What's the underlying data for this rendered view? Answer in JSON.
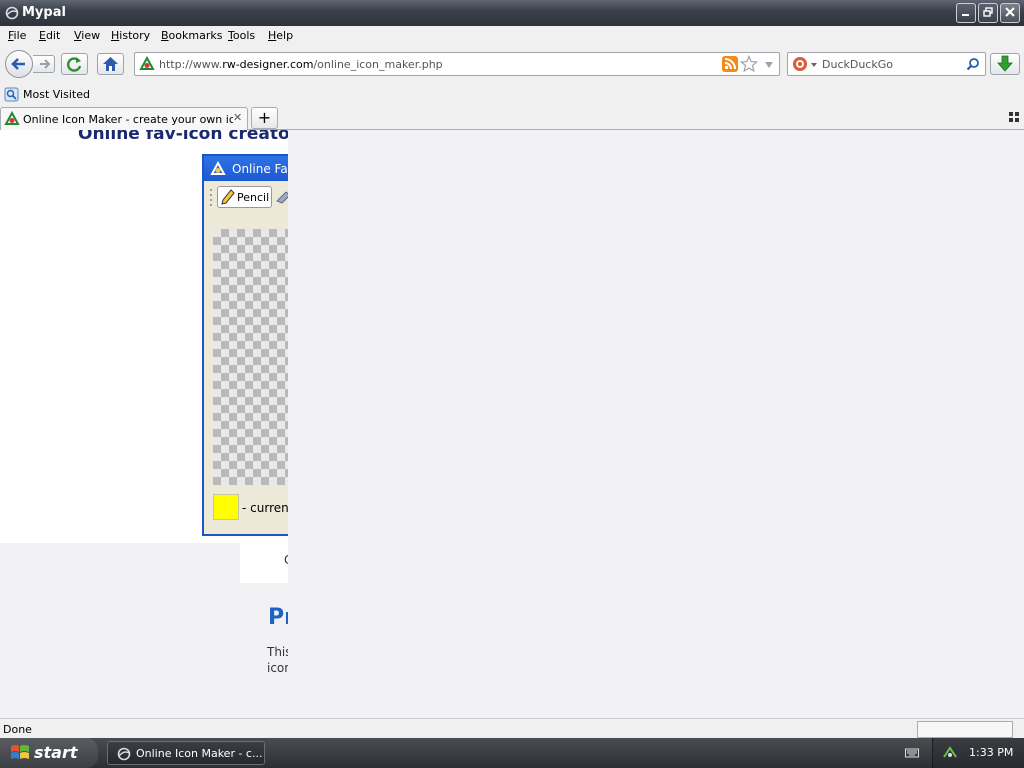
{
  "window": {
    "title": "Mypal"
  },
  "menu": [
    {
      "label": "File",
      "key": "F",
      "rest": "ile"
    },
    {
      "label": "Edit",
      "key": "E",
      "rest": "dit"
    },
    {
      "label": "View",
      "key": "V",
      "rest": "iew"
    },
    {
      "label": "History",
      "key": "H",
      "rest": "istory"
    },
    {
      "label": "Bookmarks",
      "key": "B",
      "rest": "ookmarks"
    },
    {
      "label": "Tools",
      "key": "T",
      "rest": "ools"
    },
    {
      "label": "Help",
      "key": "H",
      "rest": "elp"
    }
  ],
  "nav": {
    "url_prefix": "http://www.",
    "url_domain": "rw-designer.com",
    "url_path": "/online_icon_maker.php",
    "search_engine": "DuckDuckGo"
  },
  "bookmarks": {
    "most_visited": "Most Visited"
  },
  "tabs": [
    {
      "label": "Online Icon Maker - create your own icon..."
    }
  ],
  "page": {
    "heading": "Online fav-icon creator",
    "app_title": "Online Fav",
    "pencil_label": "Pencil",
    "current_label": "- current",
    "lower_char": "C",
    "section_title": "Pr",
    "section_line1": "This",
    "section_line2": "icon"
  },
  "status": {
    "text": "Done"
  },
  "taskbar": {
    "start": "start",
    "task_label": "Online Icon Maker - c...",
    "clock": "1:33 PM"
  },
  "colors": {
    "current_color": "#ffff00",
    "heading": "#1b2a6e",
    "section_title": "#1f62c6"
  }
}
